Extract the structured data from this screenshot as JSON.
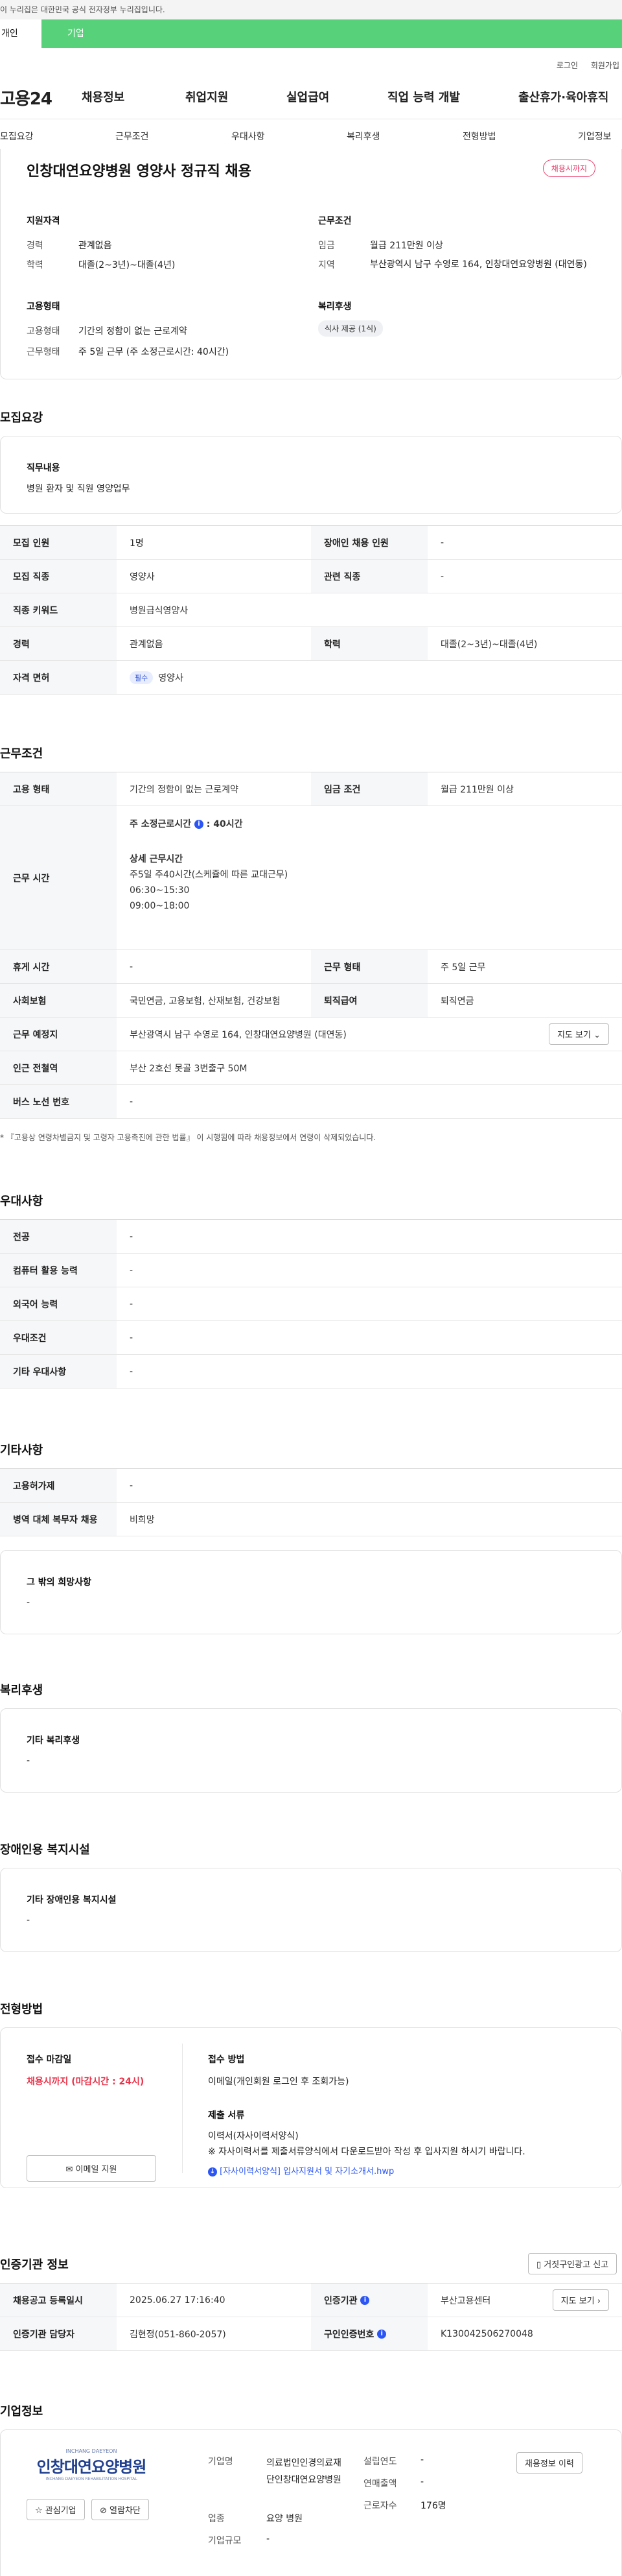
{
  "gov_banner": "이 누리집은 대한민국 공식 전자정부 누리집입니다.",
  "top_tabs": {
    "individual": "개인",
    "corporate": "기업"
  },
  "util": {
    "login": "로그인",
    "signup": "회원가입"
  },
  "gnb": {
    "logo": "고용24",
    "items": [
      "채용정보",
      "취업지원",
      "실업급여",
      "직업 능력 개발",
      "출산휴가·육아휴직"
    ]
  },
  "subnav": [
    "모집요강",
    "근무조건",
    "우대사항",
    "복리후생",
    "전형방법",
    "기업정보"
  ],
  "job": {
    "title": "인창대연요양병원 영양사 정규직 채용",
    "deadline_badge": "채용시까지",
    "qual_title": "지원자격",
    "career_label": "경력",
    "career_value": "관계없음",
    "edu_label": "학력",
    "edu_value": "대졸(2~3년)~대졸(4년)",
    "work_title": "근무조건",
    "wage_label": "임금",
    "wage_value": "월급 211만원 이상",
    "region_label": "지역",
    "region_value": "부산광역시 남구 수영로 164, 인창대연요양병원 (대연동)",
    "emp_title": "고용형태",
    "emp_type_label": "고용형태",
    "emp_type_value": "기간의 정함이 없는 근로계약",
    "work_form_label": "근무형태",
    "work_form_value": "주 5일 근무 (주 소정근로시간: 40시간)",
    "welfare_title": "복리후생",
    "welfare_chip": "식사 제공 (1식)"
  },
  "recruit": {
    "section": "모집요강",
    "duty_title": "직무내용",
    "duty_value": "병원 환자 및 직원 영양업무",
    "rows": {
      "headcount_label": "모집 인원",
      "headcount": "1명",
      "disabled_label": "장애인 채용 인원",
      "disabled": "-",
      "job_label": "모집 직종",
      "job": "영양사",
      "related_label": "관련 직종",
      "related": "-",
      "keyword_label": "직종 키워드",
      "keyword": "병원급식영양사",
      "career_label": "경력",
      "career": "관계없음",
      "edu_label": "학력",
      "edu": "대졸(2~3년)~대졸(4년)",
      "license_label": "자격 면허",
      "license_tag": "필수",
      "license": "영양사"
    }
  },
  "conditions": {
    "section": "근무조건",
    "emp_label": "고용 형태",
    "emp": "기간의 정함이 없는 근로계약",
    "wage_label": "임금 조건",
    "wage": "월급 211만원 이상",
    "hours_label": "근무 시간",
    "hours_weekly": "주 소정근로시간",
    "hours_weekly_val": ": 40시간",
    "hours_detail_title": "상세 근무시간",
    "hours_detail_1": "주5일 주40시간(스케쥴에 따른 교대근무)",
    "hours_detail_2": "06:30~15:30",
    "hours_detail_3": "09:00~18:00",
    "rest_label": "휴게 시간",
    "rest": "-",
    "form_label": "근무 형태",
    "form": "주 5일 근무",
    "insurance_label": "사회보험",
    "insurance": "국민연금, 고용보험, 산재보험, 건강보험",
    "retire_label": "퇴직급여",
    "retire": "퇴직연금",
    "place_label": "근무 예정지",
    "place": "부산광역시 남구 수영로 164, 인창대연요양병원 (대연동)",
    "map_btn": "지도 보기",
    "subway_label": "인근 전철역",
    "subway": "부산 2호선 못골 3번출구 50M",
    "bus_label": "버스 노선 번호",
    "bus": "-",
    "note": "* 『고용상 연령차별금지 및 고령자 고용촉진에 관한 법률』 이 시행됨에 따라 채용정보에서 연령이 삭제되었습니다."
  },
  "preference": {
    "section": "우대사항",
    "major_label": "전공",
    "major": "-",
    "computer_label": "컴퓨터 활용 능력",
    "computer": "-",
    "language_label": "외국어 능력",
    "language": "-",
    "cond_label": "우대조건",
    "cond": "-",
    "etc_label": "기타 우대사항",
    "etc": "-"
  },
  "other": {
    "section": "기타사항",
    "permit_label": "고용허가제",
    "permit": "-",
    "military_label": "병역 대체 복무자 채용",
    "military": "비희망",
    "extra_title": "그 밖의 희망사항",
    "extra": "-"
  },
  "welfare": {
    "section": "복리후생",
    "title": "기타 복리후생",
    "value": "-"
  },
  "facility": {
    "section": "장애인용 복지시설",
    "title": "기타 장애인용 복지시설",
    "value": "-"
  },
  "process": {
    "section": "전형방법",
    "deadline_title": "접수 마감일",
    "deadline_value": "채용시까지 (마감시간 : 24시)",
    "email_btn": "이메일 지원",
    "method_title": "접수 방법",
    "method_value": "이메일(개인회원 로그인 후 조회가능)",
    "docs_title": "제출 서류",
    "docs_1": "이력서(자사이력서양식)",
    "docs_2": "※ 자사이력서를 제출서류양식에서 다운로드받아 작성 후 입사지원 하시기 바랍니다.",
    "docs_link": "[자사이력서양식] 입사지원서 및 자기소개서.hwp"
  },
  "cert": {
    "section": "인증기관 정보",
    "report_btn": "거짓구인광고 신고",
    "reg_label": "채용공고 등록일시",
    "reg": "2025.06.27 17:16:40",
    "org_label": "인증기관",
    "org": "부산고용센터",
    "map_btn": "지도 보기",
    "contact_label": "인증기관 담당자",
    "contact": "김현정(051-860-2057)",
    "id_label": "구인인증번호",
    "id": "K130042506270048"
  },
  "company": {
    "section": "기업정보",
    "logo_small": "INCHANG DAEYEON",
    "logo_text": "인창대연요양병원",
    "logo_en": "INCHANG DAEYEON REHABILITATION HOSPITAL",
    "fav_btn": "관심기업",
    "block_btn": "열람차단",
    "name_label": "기업명",
    "name": "의료법인인경의료재단인창대연요양병원",
    "industry_label": "업종",
    "industry": "요양 병원",
    "size_label": "기업규모",
    "size": "-",
    "founded_label": "설립연도",
    "founded": "-",
    "sales_label": "연매출액",
    "sales": "-",
    "staff_label": "근로자수",
    "staff": "176명",
    "jobs_btn": "채용정보 이력"
  }
}
